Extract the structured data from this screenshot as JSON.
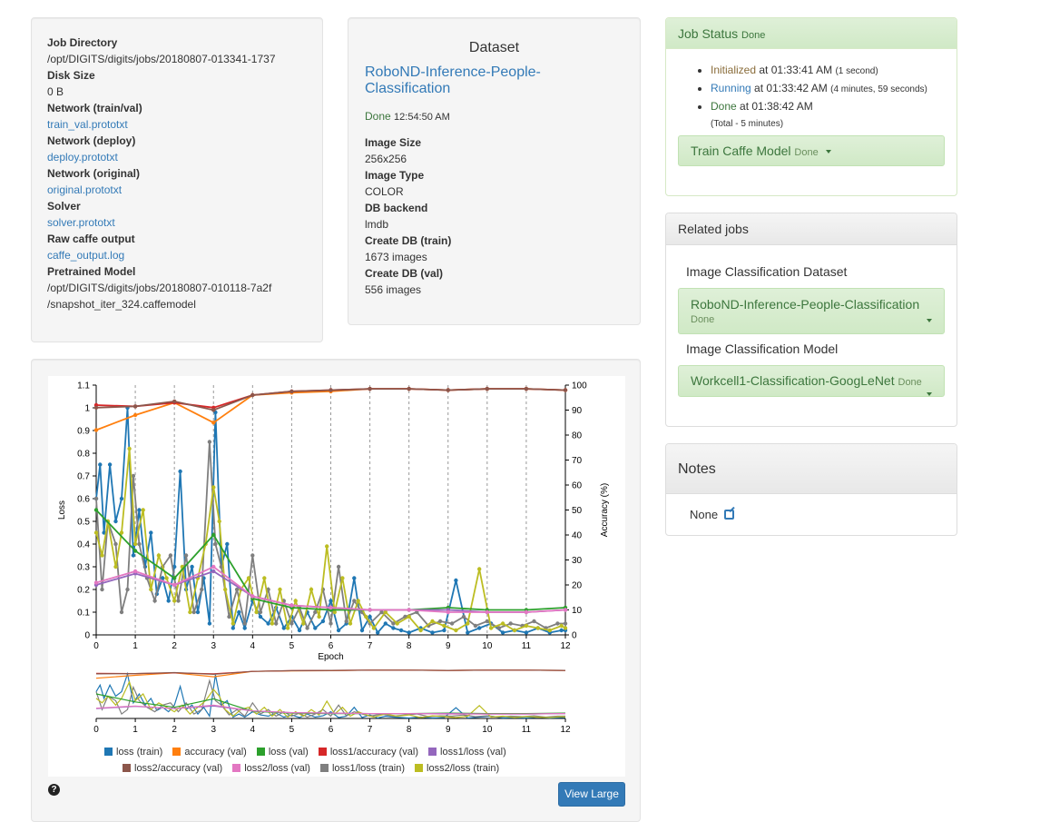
{
  "job_info": {
    "items": [
      {
        "label": "Job Directory",
        "value": "/opt/DIGITS/digits/jobs/20180807-013341-1737",
        "link": false
      },
      {
        "label": "Disk Size",
        "value": "0 B",
        "link": false
      },
      {
        "label": "Network (train/val)",
        "value": "train_val.prototxt",
        "link": true
      },
      {
        "label": "Network (deploy)",
        "value": "deploy.prototxt",
        "link": true
      },
      {
        "label": "Network (original)",
        "value": "original.prototxt",
        "link": true
      },
      {
        "label": "Solver",
        "value": "solver.prototxt",
        "link": true
      },
      {
        "label": "Raw caffe output",
        "value": "caffe_output.log",
        "link": true
      },
      {
        "label": "Pretrained Model",
        "value": "/opt/DIGITS/digits/jobs/20180807-010118-7a2f",
        "link": false
      }
    ],
    "pretrained_extra": "/snapshot_iter_324.caffemodel"
  },
  "dataset": {
    "header": "Dataset",
    "name": "RoboND-Inference-People-Classification",
    "status": "Done",
    "status_time": "12:54:50 AM",
    "items": [
      {
        "label": "Image Size",
        "value": "256x256"
      },
      {
        "label": "Image Type",
        "value": "COLOR"
      },
      {
        "label": "DB backend",
        "value": "lmdb"
      },
      {
        "label": "Create DB (train)",
        "value": "1673 images"
      },
      {
        "label": "Create DB (val)",
        "value": "556 images"
      }
    ]
  },
  "job_status": {
    "title": "Job Status",
    "state": "Done",
    "steps": [
      {
        "name": "Initialized",
        "at": "at 01:33:41 AM",
        "detail": "(1 second)"
      },
      {
        "name": "Running",
        "at": "at 01:33:42 AM",
        "detail": "(4 minutes, 59 seconds)"
      },
      {
        "name": "Done",
        "at": "at 01:38:42 AM",
        "detail": ""
      }
    ],
    "total": "(Total - 5 minutes)",
    "task_name": "Train Caffe Model",
    "task_state": "Done"
  },
  "related_jobs": {
    "title": "Related jobs",
    "dataset_label": "Image Classification Dataset",
    "dataset_name": "RoboND-Inference-People-Classification",
    "dataset_state": "Done",
    "model_label": "Image Classification Model",
    "model_name": "Workcell1-Classification-GoogLeNet",
    "model_state": "Done"
  },
  "notes": {
    "title": "Notes",
    "value": "None"
  },
  "buttons": {
    "view_large": "View Large",
    "help": "?"
  },
  "colors": {
    "loss_train": "#1f77b4",
    "accuracy_val": "#ff7f0e",
    "loss_val": "#2ca02c",
    "loss1_accuracy_val": "#d62728",
    "loss1_loss_val": "#9467bd",
    "loss2_accuracy_val": "#8c564b",
    "loss2_loss_val": "#e377c2",
    "loss1_loss_train": "#7f7f7f",
    "loss2_loss_train": "#bcbd22"
  },
  "chart_data": {
    "type": "line",
    "xlabel": "Epoch",
    "ylabel": "Loss",
    "y2label": "Accuracy (%)",
    "xlim": [
      0,
      12
    ],
    "ylim": [
      0,
      1.1
    ],
    "y2lim": [
      0,
      100
    ],
    "x_ticks": [
      "0",
      "1",
      "2",
      "3",
      "4",
      "5",
      "6",
      "7",
      "8",
      "9",
      "10",
      "11",
      "12"
    ],
    "y_ticks": [
      "0",
      "0.1",
      "0.2",
      "0.3",
      "0.4",
      "0.5",
      "0.6",
      "0.7",
      "0.8",
      "0.9",
      "1",
      "1.1"
    ],
    "y2_ticks": [
      "0",
      "10",
      "20",
      "30",
      "40",
      "50",
      "60",
      "70",
      "80",
      "90",
      "100"
    ],
    "grid": "vertical dashed lines at each epoch",
    "legend_position": "bottom",
    "val_epochs": [
      0,
      1,
      2,
      3,
      4,
      5,
      6,
      7,
      8,
      9,
      10,
      11,
      12
    ],
    "series": [
      {
        "name": "accuracy (val)",
        "axis": "y2",
        "color_key": "accuracy_val",
        "values": [
          82,
          88,
          93,
          85,
          96,
          97,
          97.5,
          98.5,
          98.5,
          98,
          98.5,
          98.5,
          98
        ]
      },
      {
        "name": "loss1/accuracy (val)",
        "axis": "y2",
        "color_key": "loss1_accuracy_val",
        "values": [
          92,
          91.5,
          93,
          91,
          96,
          97.5,
          98,
          98.5,
          98.5,
          98,
          98.5,
          98.5,
          98
        ]
      },
      {
        "name": "loss2/accuracy (val)",
        "axis": "y2",
        "color_key": "loss2_accuracy_val",
        "values": [
          91,
          91.5,
          93.5,
          90,
          96,
          97.5,
          98,
          98.5,
          98.5,
          98,
          98.5,
          98.5,
          98
        ]
      },
      {
        "name": "loss (val)",
        "axis": "y",
        "color_key": "loss_val",
        "values": [
          0.55,
          0.37,
          0.25,
          0.44,
          0.16,
          0.12,
          0.11,
          0.11,
          0.11,
          0.12,
          0.11,
          0.11,
          0.12
        ]
      },
      {
        "name": "loss1/loss (val)",
        "axis": "y",
        "color_key": "loss1_loss_val",
        "values": [
          0.22,
          0.27,
          0.22,
          0.28,
          0.17,
          0.13,
          0.12,
          0.11,
          0.11,
          0.11,
          0.1,
          0.1,
          0.11
        ]
      },
      {
        "name": "loss2/loss (val)",
        "axis": "y",
        "color_key": "loss2_loss_val",
        "values": [
          0.23,
          0.28,
          0.22,
          0.3,
          0.17,
          0.13,
          0.12,
          0.11,
          0.11,
          0.1,
          0.1,
          0.1,
          0.11
        ]
      },
      {
        "name": "loss (train)",
        "axis": "y",
        "color_key": "loss_train",
        "x": [
          0,
          0.1,
          0.2,
          0.35,
          0.5,
          0.65,
          0.8,
          0.95,
          1.1,
          1.25,
          1.4,
          1.55,
          1.7,
          1.85,
          2.0,
          2.15,
          2.3,
          2.45,
          2.6,
          2.75,
          2.9,
          3.05,
          3.2,
          3.35,
          3.5,
          3.65,
          3.8,
          4.0,
          4.2,
          4.4,
          4.6,
          4.8,
          5.0,
          5.2,
          5.4,
          5.6,
          5.8,
          6.0,
          6.2,
          6.4,
          6.6,
          6.8,
          7.0,
          7.2,
          7.4,
          7.6,
          7.8,
          8.0,
          8.3,
          8.6,
          8.9,
          9.2,
          9.5,
          9.8,
          10.1,
          10.4,
          10.7,
          11.0,
          11.3,
          11.6,
          11.9,
          12.0
        ],
        "values": [
          0.6,
          0.75,
          0.45,
          0.75,
          0.5,
          0.6,
          1.0,
          0.35,
          0.55,
          0.3,
          0.45,
          0.18,
          0.25,
          0.15,
          0.3,
          0.72,
          0.2,
          0.3,
          0.1,
          0.25,
          0.05,
          0.98,
          0.3,
          0.4,
          0.03,
          0.1,
          0.03,
          0.15,
          0.08,
          0.05,
          0.12,
          0.03,
          0.08,
          0.02,
          0.1,
          0.03,
          0.06,
          0.15,
          0.02,
          0.05,
          0.25,
          0.02,
          0.08,
          0.01,
          0.05,
          0.03,
          0.02,
          0.01,
          0.03,
          0.01,
          0.02,
          0.24,
          0.01,
          0.03,
          0.05,
          0.01,
          0.02,
          0.01,
          0.03,
          0.01,
          0.02,
          0.02
        ]
      },
      {
        "name": "loss1/loss (train)",
        "axis": "y",
        "color_key": "loss1_loss_train",
        "x": [
          0,
          0.15,
          0.3,
          0.5,
          0.65,
          0.8,
          0.95,
          1.1,
          1.3,
          1.5,
          1.7,
          1.9,
          2.1,
          2.3,
          2.5,
          2.7,
          2.9,
          3.05,
          3.2,
          3.4,
          3.6,
          3.8,
          4.0,
          4.2,
          4.4,
          4.6,
          4.8,
          5.0,
          5.2,
          5.4,
          5.6,
          5.8,
          6.0,
          6.2,
          6.4,
          6.6,
          6.8,
          7.0,
          7.3,
          7.6,
          7.9,
          8.2,
          8.5,
          8.8,
          9.1,
          9.4,
          9.7,
          10.0,
          10.3,
          10.6,
          10.9,
          11.2,
          11.5,
          11.8,
          12.0
        ],
        "values": [
          0.6,
          0.2,
          0.5,
          0.4,
          0.1,
          0.2,
          0.7,
          0.4,
          0.25,
          0.15,
          0.3,
          0.35,
          0.15,
          0.35,
          0.1,
          0.2,
          0.85,
          0.4,
          0.3,
          0.08,
          0.2,
          0.05,
          0.35,
          0.1,
          0.2,
          0.05,
          0.15,
          0.05,
          0.12,
          0.03,
          0.1,
          0.2,
          0.05,
          0.3,
          0.06,
          0.15,
          0.1,
          0.05,
          0.1,
          0.05,
          0.08,
          0.1,
          0.04,
          0.06,
          0.05,
          0.08,
          0.04,
          0.06,
          0.03,
          0.05,
          0.04,
          0.06,
          0.03,
          0.05,
          0.05
        ]
      },
      {
        "name": "loss2/loss (train)",
        "axis": "y",
        "color_key": "loss2_loss_train",
        "x": [
          0,
          0.15,
          0.3,
          0.5,
          0.65,
          0.85,
          1.0,
          1.2,
          1.4,
          1.6,
          1.8,
          2.0,
          2.2,
          2.4,
          2.6,
          2.8,
          3.0,
          3.15,
          3.3,
          3.5,
          3.7,
          3.9,
          4.1,
          4.3,
          4.5,
          4.7,
          4.9,
          5.1,
          5.3,
          5.5,
          5.7,
          5.9,
          6.1,
          6.3,
          6.5,
          6.7,
          6.9,
          7.1,
          7.4,
          7.7,
          8.0,
          8.3,
          8.6,
          8.9,
          9.2,
          9.5,
          9.8,
          10.1,
          10.4,
          10.7,
          11.0,
          11.3,
          11.6,
          11.9,
          12.0
        ],
        "values": [
          0.45,
          0.35,
          0.5,
          0.3,
          0.45,
          0.82,
          0.4,
          0.55,
          0.2,
          0.35,
          0.25,
          0.15,
          0.3,
          0.1,
          0.25,
          0.4,
          0.65,
          0.5,
          0.2,
          0.05,
          0.2,
          0.25,
          0.1,
          0.25,
          0.05,
          0.2,
          0.03,
          0.15,
          0.05,
          0.2,
          0.08,
          0.39,
          0.1,
          0.25,
          0.05,
          0.15,
          0.08,
          0.03,
          0.1,
          0.05,
          0.08,
          0.02,
          0.06,
          0.04,
          0.02,
          0.05,
          0.29,
          0.03,
          0.05,
          0.02,
          0.04,
          0.03,
          0.02,
          0.04,
          0.03
        ]
      }
    ]
  }
}
